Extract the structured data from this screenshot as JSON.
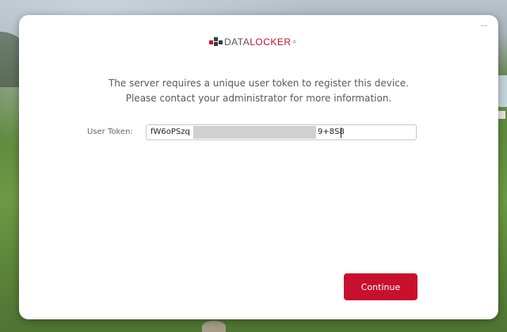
{
  "brand": {
    "name_part1": "Data",
    "name_part2": "Locker",
    "registered_mark": "®",
    "accent_color": "#c8102e"
  },
  "window": {
    "minimize_icon": "minimize-icon"
  },
  "message": {
    "line1": "The server requires a unique user token to register this device.",
    "line2": "Please contact your administrator for more information."
  },
  "token": {
    "label": "User Token:",
    "value_start": "fW6oPSzq",
    "value_end": "9+8S8"
  },
  "actions": {
    "continue_label": "Continue"
  }
}
